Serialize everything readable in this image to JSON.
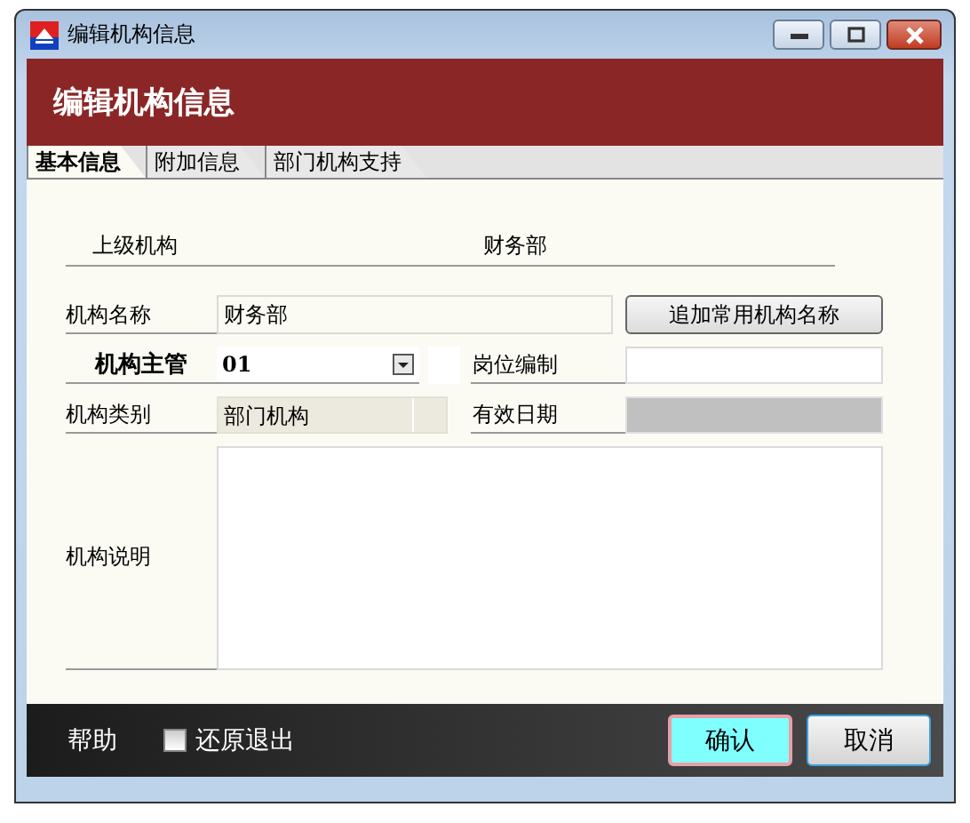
{
  "window": {
    "title": "编辑机构信息"
  },
  "banner": {
    "title": "编辑机构信息"
  },
  "tabs": [
    {
      "label": "基本信息",
      "selected": true
    },
    {
      "label": "附加信息",
      "selected": false
    },
    {
      "label": "部门机构支持",
      "selected": false
    }
  ],
  "parent": {
    "label": "上级机构",
    "value": "财务部"
  },
  "name": {
    "label": "机构名称",
    "value": "财务部",
    "button": "追加常用机构名称"
  },
  "manager": {
    "label": "机构主管",
    "value": "01"
  },
  "post": {
    "label": "岗位编制",
    "disabled": false
  },
  "type": {
    "label": "机构类别",
    "value": "部门机构",
    "disabled": true
  },
  "date": {
    "label": "有效日期",
    "disabled": true
  },
  "description": {
    "label": "机构说明"
  },
  "footer": {
    "help": "帮助",
    "checkbox": {
      "label": "还原退出",
      "checked": false
    },
    "buttons": [
      {
        "label": "确认",
        "focused": true
      },
      {
        "label": "取消",
        "focused": false
      }
    ]
  }
}
